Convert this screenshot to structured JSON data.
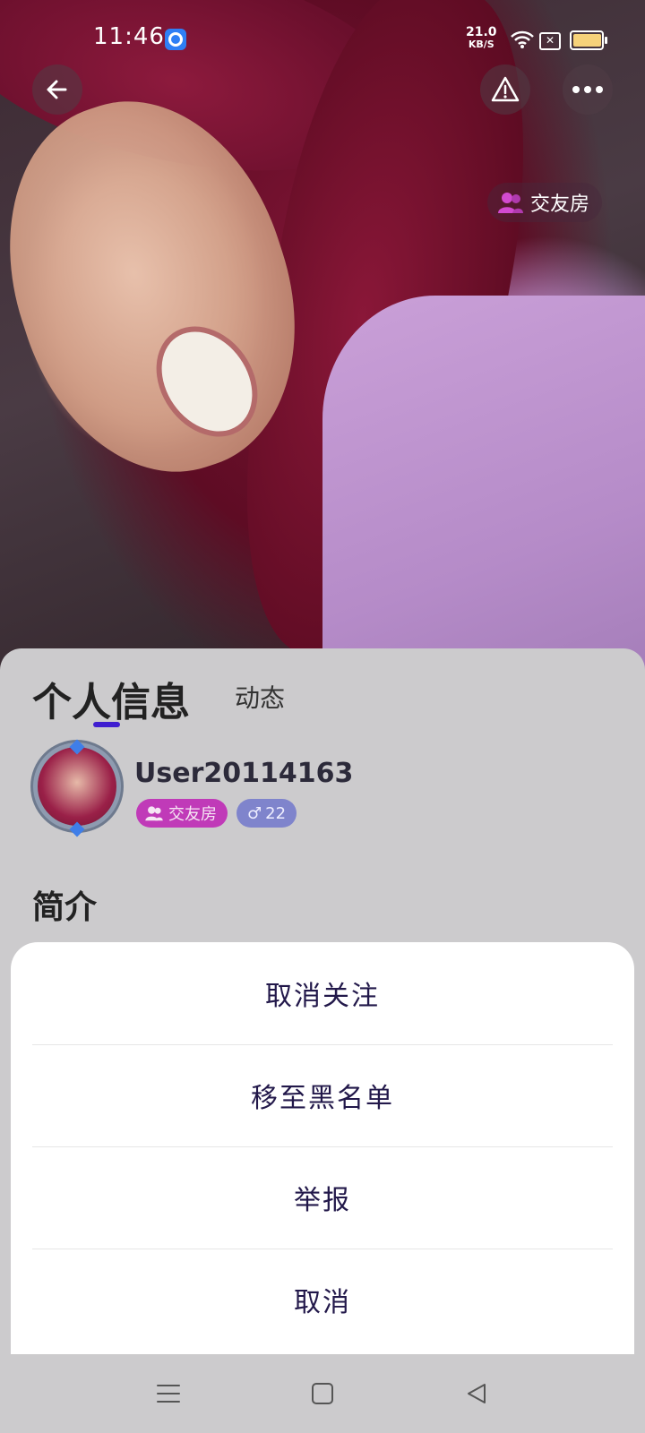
{
  "status_bar": {
    "time": "11:46",
    "net_speed_value": "21.0",
    "net_speed_unit": "KB/S",
    "battery_level": 0.9
  },
  "header": {
    "back_icon": "arrow-left-icon",
    "report_icon": "warning-icon",
    "more_icon": "ellipsis-icon",
    "room_chip_label": "交友房"
  },
  "profile": {
    "tabs": [
      {
        "label": "个人信息",
        "active": true
      },
      {
        "label": "动态",
        "active": false
      }
    ],
    "username": "User20114163",
    "room_badge": "交友房",
    "gender_symbol": "♂",
    "age": "22",
    "section_intro": "简介"
  },
  "action_sheet": {
    "items": [
      {
        "label": "取消关注"
      },
      {
        "label": "移至黑名单"
      },
      {
        "label": "举报"
      },
      {
        "label": "取消"
      }
    ]
  },
  "nav_bar": {
    "menu_icon": "menu-icon",
    "home_icon": "home-square-icon",
    "back_icon": "back-triangle-icon"
  },
  "colors": {
    "accent": "#3f1ed0",
    "room_badge_bg": "#c03ab8",
    "gender_badge_bg": "#7f84cc",
    "action_text": "#22184a"
  }
}
